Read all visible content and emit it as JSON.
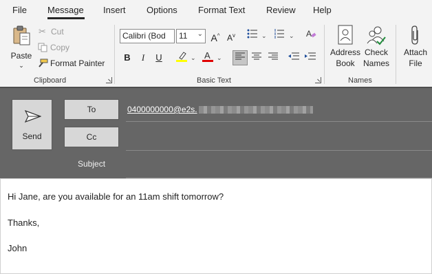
{
  "tabs": [
    "File",
    "Message",
    "Insert",
    "Options",
    "Format Text",
    "Review",
    "Help"
  ],
  "active_tab": "Message",
  "ribbon": {
    "clipboard": {
      "paste_label": "Paste",
      "cut_label": "Cut",
      "copy_label": "Copy",
      "format_painter_label": "Format Painter",
      "group_label": "Clipboard"
    },
    "basic_text": {
      "font_name": "Calibri (Bod",
      "font_size": "11",
      "bold": "B",
      "italic": "I",
      "underline": "U",
      "group_label": "Basic Text",
      "highlight_color": "#ffff00",
      "font_color": "#e00000"
    },
    "names": {
      "address_book_label": "Address Book",
      "check_names_label": "Check Names",
      "group_label": "Names"
    },
    "attach": {
      "attach_file_label": "Attach File"
    }
  },
  "header": {
    "send_label": "Send",
    "to_label": "To",
    "cc_label": "Cc",
    "subject_label": "Subject",
    "to_value": "0400000000@e2s."
  },
  "message_body": {
    "line1": "Hi Jane, are you available for an 11am shift tomorrow?",
    "line2": "Thanks,",
    "line3": "John"
  }
}
